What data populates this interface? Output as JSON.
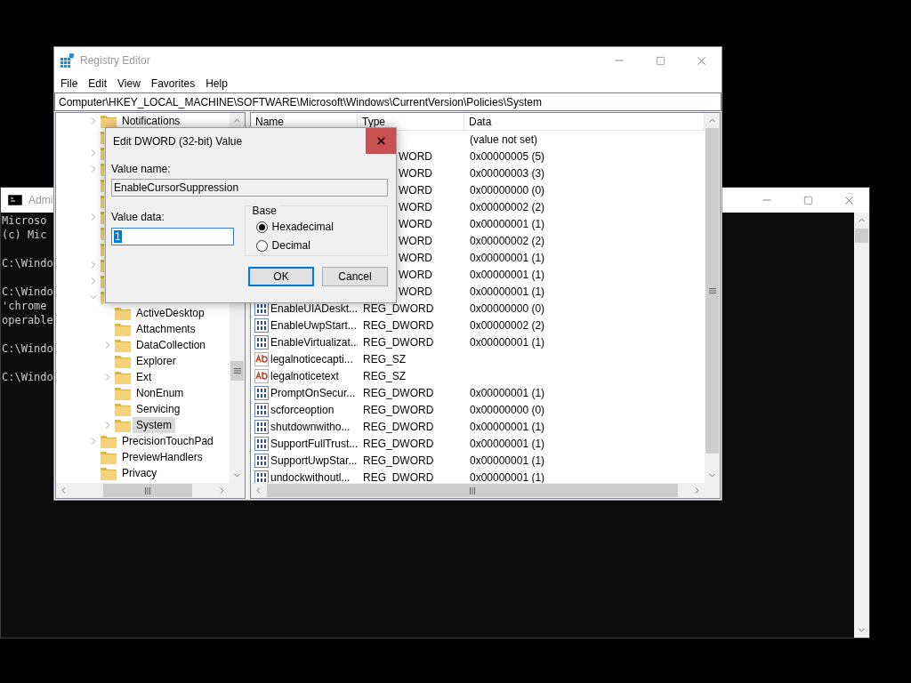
{
  "console_window": {
    "title": "Admi",
    "blocks": [
      [
        "Microso",
        "(c) Mic"
      ],
      [
        "C:\\Windo"
      ],
      [
        "C:\\Windo",
        "'chrome",
        "operable"
      ],
      [
        "C:\\Windo"
      ],
      [
        "C:\\Windo"
      ]
    ]
  },
  "registry_window": {
    "title": "Registry Editor",
    "menu": [
      "File",
      "Edit",
      "View",
      "Favorites",
      "Help"
    ],
    "address": "Computer\\HKEY_LOCAL_MACHINE\\SOFTWARE\\Microsoft\\Windows\\CurrentVersion\\Policies\\System",
    "tree": [
      {
        "label": "Notifications",
        "expanded": false
      },
      {
        "kind": "covered"
      },
      {
        "kind": "covered",
        "expanded": false
      },
      {
        "kind": "covered",
        "expanded": false
      },
      {
        "kind": "covered"
      },
      {
        "kind": "covered"
      },
      {
        "kind": "covered",
        "expanded": false
      },
      {
        "kind": "covered"
      },
      {
        "kind": "covered"
      },
      {
        "kind": "covered",
        "expanded": false
      },
      {
        "kind": "covered",
        "expanded": false
      },
      {
        "kind": "covered",
        "expanded": true,
        "children": [
          {
            "label": "ActiveDesktop",
            "selected": false
          },
          {
            "label": "Attachments",
            "selected": false
          },
          {
            "label": "DataCollection",
            "expanded": false,
            "selected": false
          },
          {
            "label": "Explorer",
            "selected": false
          },
          {
            "label": "Ext",
            "expanded": false,
            "selected": false
          },
          {
            "label": "NonEnum",
            "selected": false
          },
          {
            "label": "Servicing",
            "selected": false
          },
          {
            "label": "System",
            "expanded": false,
            "selected": true
          }
        ]
      },
      {
        "label": "PrecisionTouchPad",
        "expanded": false
      },
      {
        "label": "PreviewHandlers"
      },
      {
        "label": "Privacy"
      }
    ],
    "columns": [
      "Name",
      "Type",
      "Data"
    ],
    "rows": [
      {
        "data": "(value not set)"
      },
      {
        "type": "WORD",
        "data": "0x00000005 (5)"
      },
      {
        "type": "WORD",
        "data": "0x00000003 (3)"
      },
      {
        "type": "WORD",
        "data": "0x00000000 (0)"
      },
      {
        "type": "WORD",
        "data": "0x00000002 (2)"
      },
      {
        "type": "WORD",
        "data": "0x00000001 (1)"
      },
      {
        "type": "WORD",
        "data": "0x00000002 (2)"
      },
      {
        "type": "WORD",
        "data": "0x00000001 (1)"
      },
      {
        "type": "WORD",
        "data": "0x00000001 (1)"
      },
      {
        "type": "WORD",
        "data": "0x00000001 (1)"
      },
      {
        "kind": "dword",
        "name": "EnableUIADeskt...",
        "type": "REG_DWORD",
        "data": "0x00000000 (0)"
      },
      {
        "kind": "dword",
        "name": "EnableUwpStart...",
        "type": "REG_DWORD",
        "data": "0x00000002 (2)"
      },
      {
        "kind": "dword",
        "name": "EnableVirtualizat...",
        "type": "REG_DWORD",
        "data": "0x00000001 (1)"
      },
      {
        "kind": "string",
        "name": "legalnoticecapti...",
        "type": "REG_SZ"
      },
      {
        "kind": "string",
        "name": "legalnoticetext",
        "type": "REG_SZ"
      },
      {
        "kind": "dword",
        "name": "PromptOnSecur...",
        "type": "REG_DWORD",
        "data": "0x00000001 (1)"
      },
      {
        "kind": "dword",
        "name": "scforceoption",
        "type": "REG_DWORD",
        "data": "0x00000000 (0)"
      },
      {
        "kind": "dword",
        "name": "shutdownwitho...",
        "type": "REG_DWORD",
        "data": "0x00000001 (1)"
      },
      {
        "kind": "dword",
        "name": "SupportFullTrust...",
        "type": "REG_DWORD",
        "data": "0x00000001 (1)"
      },
      {
        "kind": "dword",
        "name": "SupportUwpStar...",
        "type": "REG_DWORD",
        "data": "0x00000001 (1)"
      },
      {
        "kind": "dword",
        "name": "undockwithoutl...",
        "type": "REG_DWORD",
        "data": "0x00000001 (1)"
      }
    ]
  },
  "dialog": {
    "title": "Edit DWORD (32-bit) Value",
    "value_name_label": "Value name:",
    "value_name": "EnableCursorSuppression",
    "value_data_label": "Value data:",
    "value_data": "1",
    "base_label": "Base",
    "base_options": [
      {
        "label": "Hexadecimal",
        "selected": true
      },
      {
        "label": "Decimal",
        "selected": false
      }
    ],
    "buttons": [
      {
        "label": "OK",
        "default": true
      },
      {
        "label": "Cancel",
        "default": false
      }
    ]
  }
}
